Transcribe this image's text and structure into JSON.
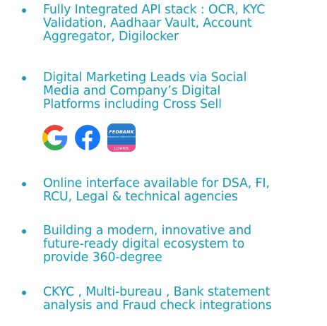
{
  "bullets": [
    "Fully Integrated API stack : OCR,  KYC\nValidation, Aadhaar Vault, Account\nAggregator, Digilocker",
    "Digital Marketing Leads via Social\nMedia and Company’s Digital\nPlatforms including Cross Sell",
    "Online interface available for DSA, FI,\nRCU, Legal & technical agencies",
    "Building a modern, innovative and\nfuture-ready digital ecosystem to\nprovide 360-degree",
    "CKYC , Multi-bureau , Bank statement\nanalysis and Fraud check integrations"
  ],
  "icons": {
    "google": "google-icon",
    "facebook": "facebook-icon",
    "app": {
      "name": "FEDBANK",
      "subtitle": "FINANCIAL SERVICES LTD",
      "tag": "LOANS"
    }
  },
  "colors": {
    "text": "#139ab6",
    "bullet": "#139ab6"
  }
}
